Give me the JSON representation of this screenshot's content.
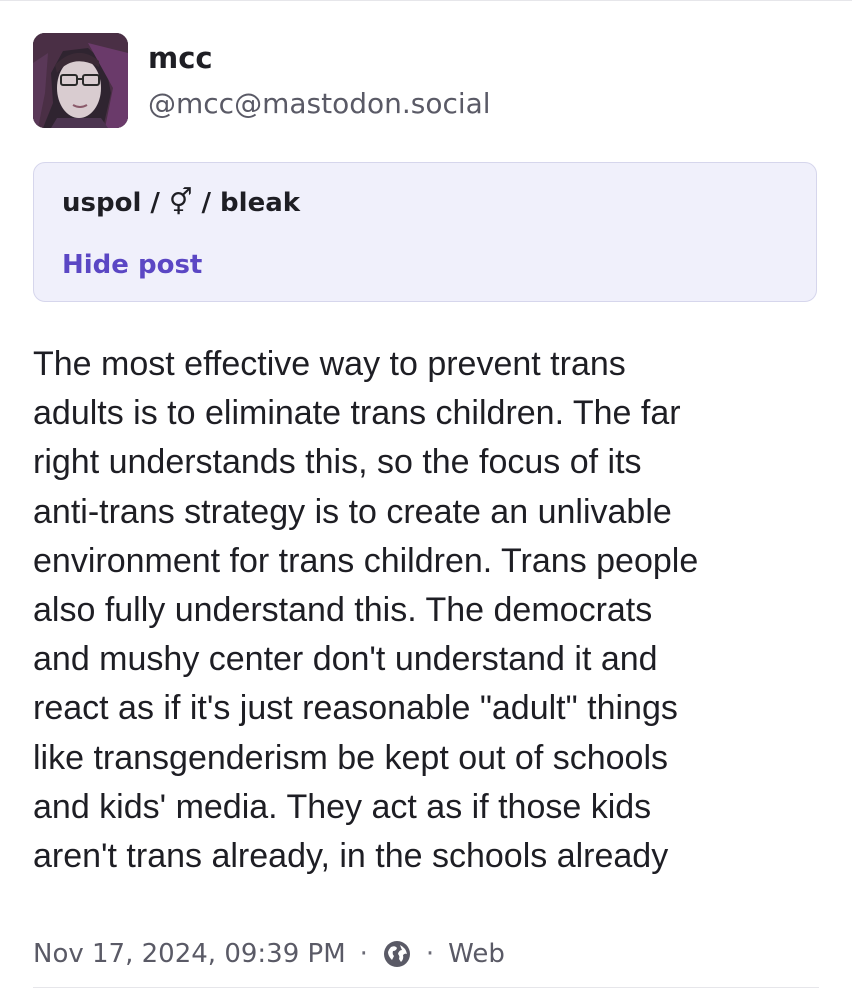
{
  "post": {
    "display_name": "mcc",
    "handle": "@mcc@mastodon.social",
    "avatar_icon": "user-avatar-drawing",
    "content_warning": "uspol / ⚥ / bleak",
    "hide_label": "Hide post",
    "lines": [
      "The most effective way to prevent trans",
      "adults is to eliminate trans children. The far",
      "right understands this, so the focus of its",
      "anti-trans strategy is to create an unlivable",
      "environment for trans children. Trans people",
      "also fully understand this. The democrats",
      "and mushy center don't understand it and",
      "react as if it's just reasonable \"adult\" things",
      "like transgenderism be kept out of schools",
      "and kids' media. They act as if those kids",
      "aren't trans already, in the schools already"
    ],
    "timestamp": "Nov 17, 2024, 09:39 PM",
    "separator": "·",
    "visibility_icon": "globe-icon",
    "application": "Web"
  },
  "colors": {
    "accent": "#5b47c4",
    "cw_background": "#f0f0fb",
    "cw_border": "#d6d6ec",
    "text": "#1e1e24",
    "muted": "#5a5a66"
  }
}
